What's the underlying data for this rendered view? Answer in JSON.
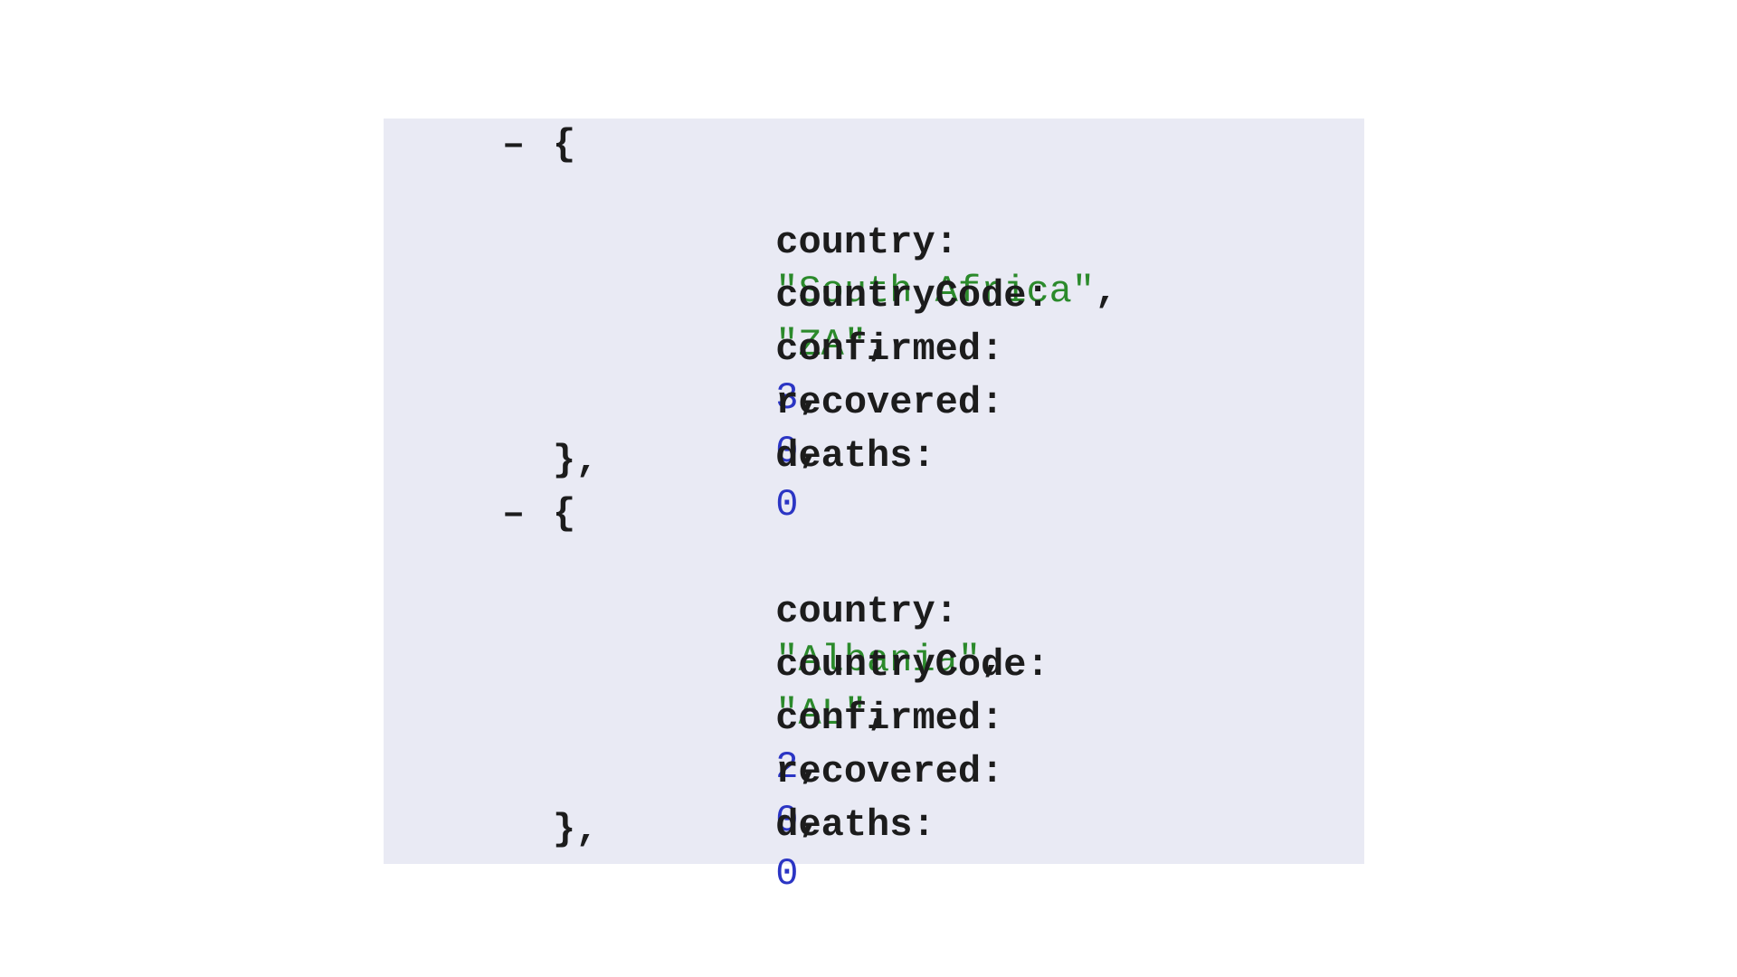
{
  "viewer": {
    "collapse_symbol": "–",
    "open_brace": "{",
    "close_brace": "},",
    "items": [
      {
        "country": {
          "key": "country:",
          "value": "\"South Africa\"",
          "sep": ","
        },
        "countryCode": {
          "key": "countryCode:",
          "value": "\"ZA\"",
          "sep": ","
        },
        "confirmed": {
          "key": "confirmed:",
          "value": "3",
          "sep": ","
        },
        "recovered": {
          "key": "recovered:",
          "value": "0",
          "sep": ","
        },
        "deaths": {
          "key": "deaths:",
          "value": "0",
          "sep": ""
        }
      },
      {
        "country": {
          "key": "country:",
          "value": "\"Albania\"",
          "sep": ","
        },
        "countryCode": {
          "key": "countryCode:",
          "value": "\"AL\"",
          "sep": ","
        },
        "confirmed": {
          "key": "confirmed:",
          "value": "2",
          "sep": ","
        },
        "recovered": {
          "key": "recovered:",
          "value": "0",
          "sep": ","
        },
        "deaths": {
          "key": "deaths:",
          "value": "0",
          "sep": ""
        }
      }
    ]
  },
  "colors": {
    "background": "#e9eaf4",
    "key": "#1c1c1c",
    "string": "#2b8a2b",
    "number": "#2b35c4"
  }
}
